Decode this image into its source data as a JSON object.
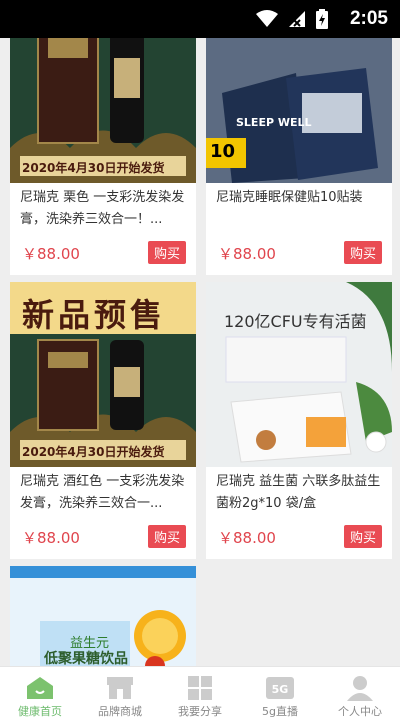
{
  "status_bar": {
    "time": "2:05"
  },
  "products": [
    {
      "title": "尼瑞克 栗色 一支彩洗发染发膏，洗染养三效合一！...",
      "price": "￥88.00",
      "buy_label": "购买",
      "banner": "2020年4月30日开始发货"
    },
    {
      "title": "尼瑞克睡眠保健贴10贴装",
      "price": "￥88.00",
      "buy_label": "购买",
      "box_label": "SLEEP WELL",
      "box_count": "10"
    },
    {
      "title": "尼瑞克 酒红色 一支彩洗发染发膏，洗染养三效合一...",
      "price": "￥88.00",
      "buy_label": "购买",
      "promo": "新品预售",
      "banner": "2020年4月30日开始发货"
    },
    {
      "title": "尼瑞克 益生菌 六联多肽益生菌粉2g*10 袋/盒",
      "price": "￥88.00",
      "buy_label": "购买",
      "headline": "120亿CFU专有活菌"
    },
    {
      "box_label": "益生元",
      "box_sub": "低聚果糖饮品"
    }
  ],
  "tabs": [
    {
      "label": "健康首页",
      "icon": "home-icon",
      "active": true
    },
    {
      "label": "品牌商城",
      "icon": "store-icon",
      "active": false
    },
    {
      "label": "我要分享",
      "icon": "grid-icon",
      "active": false
    },
    {
      "label": "5g直播",
      "icon": "5g-icon",
      "active": false
    },
    {
      "label": "个人中心",
      "icon": "person-icon",
      "active": false
    }
  ]
}
